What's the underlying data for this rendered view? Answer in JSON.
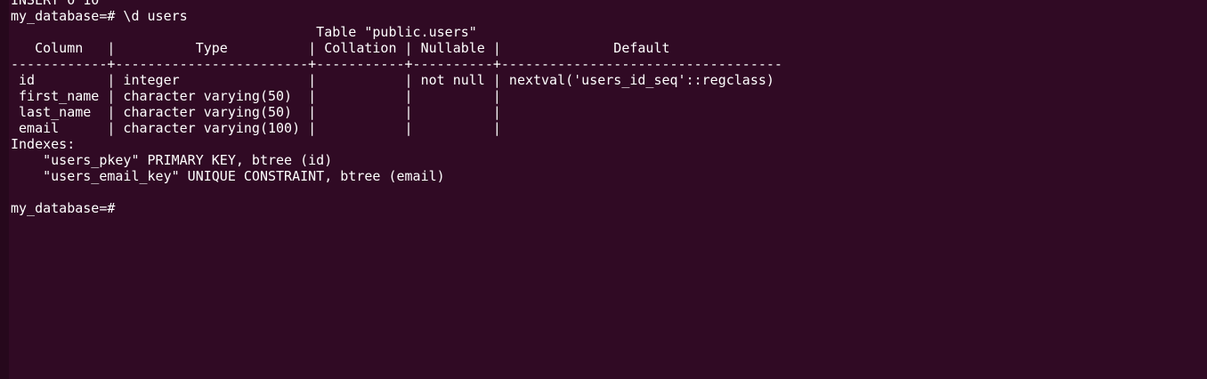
{
  "terminal": {
    "lines": [
      "INSERT 0 10",
      "my_database=# \\d users",
      "                                      Table \"public.users\"",
      "   Column   |          Type          | Collation | Nullable |              Default",
      "------------+------------------------+-----------+----------+-----------------------------------",
      " id         | integer                |           | not null | nextval('users_id_seq'::regclass)",
      " first_name | character varying(50)  |           |          |",
      " last_name  | character varying(50)  |           |          |",
      " email      | character varying(100) |           |          |",
      "Indexes:",
      "    \"users_pkey\" PRIMARY KEY, btree (id)",
      "    \"users_email_key\" UNIQUE CONSTRAINT, btree (email)",
      "",
      "my_database=#"
    ]
  },
  "colors": {
    "background": "#300a24",
    "foreground": "#ffffff"
  }
}
